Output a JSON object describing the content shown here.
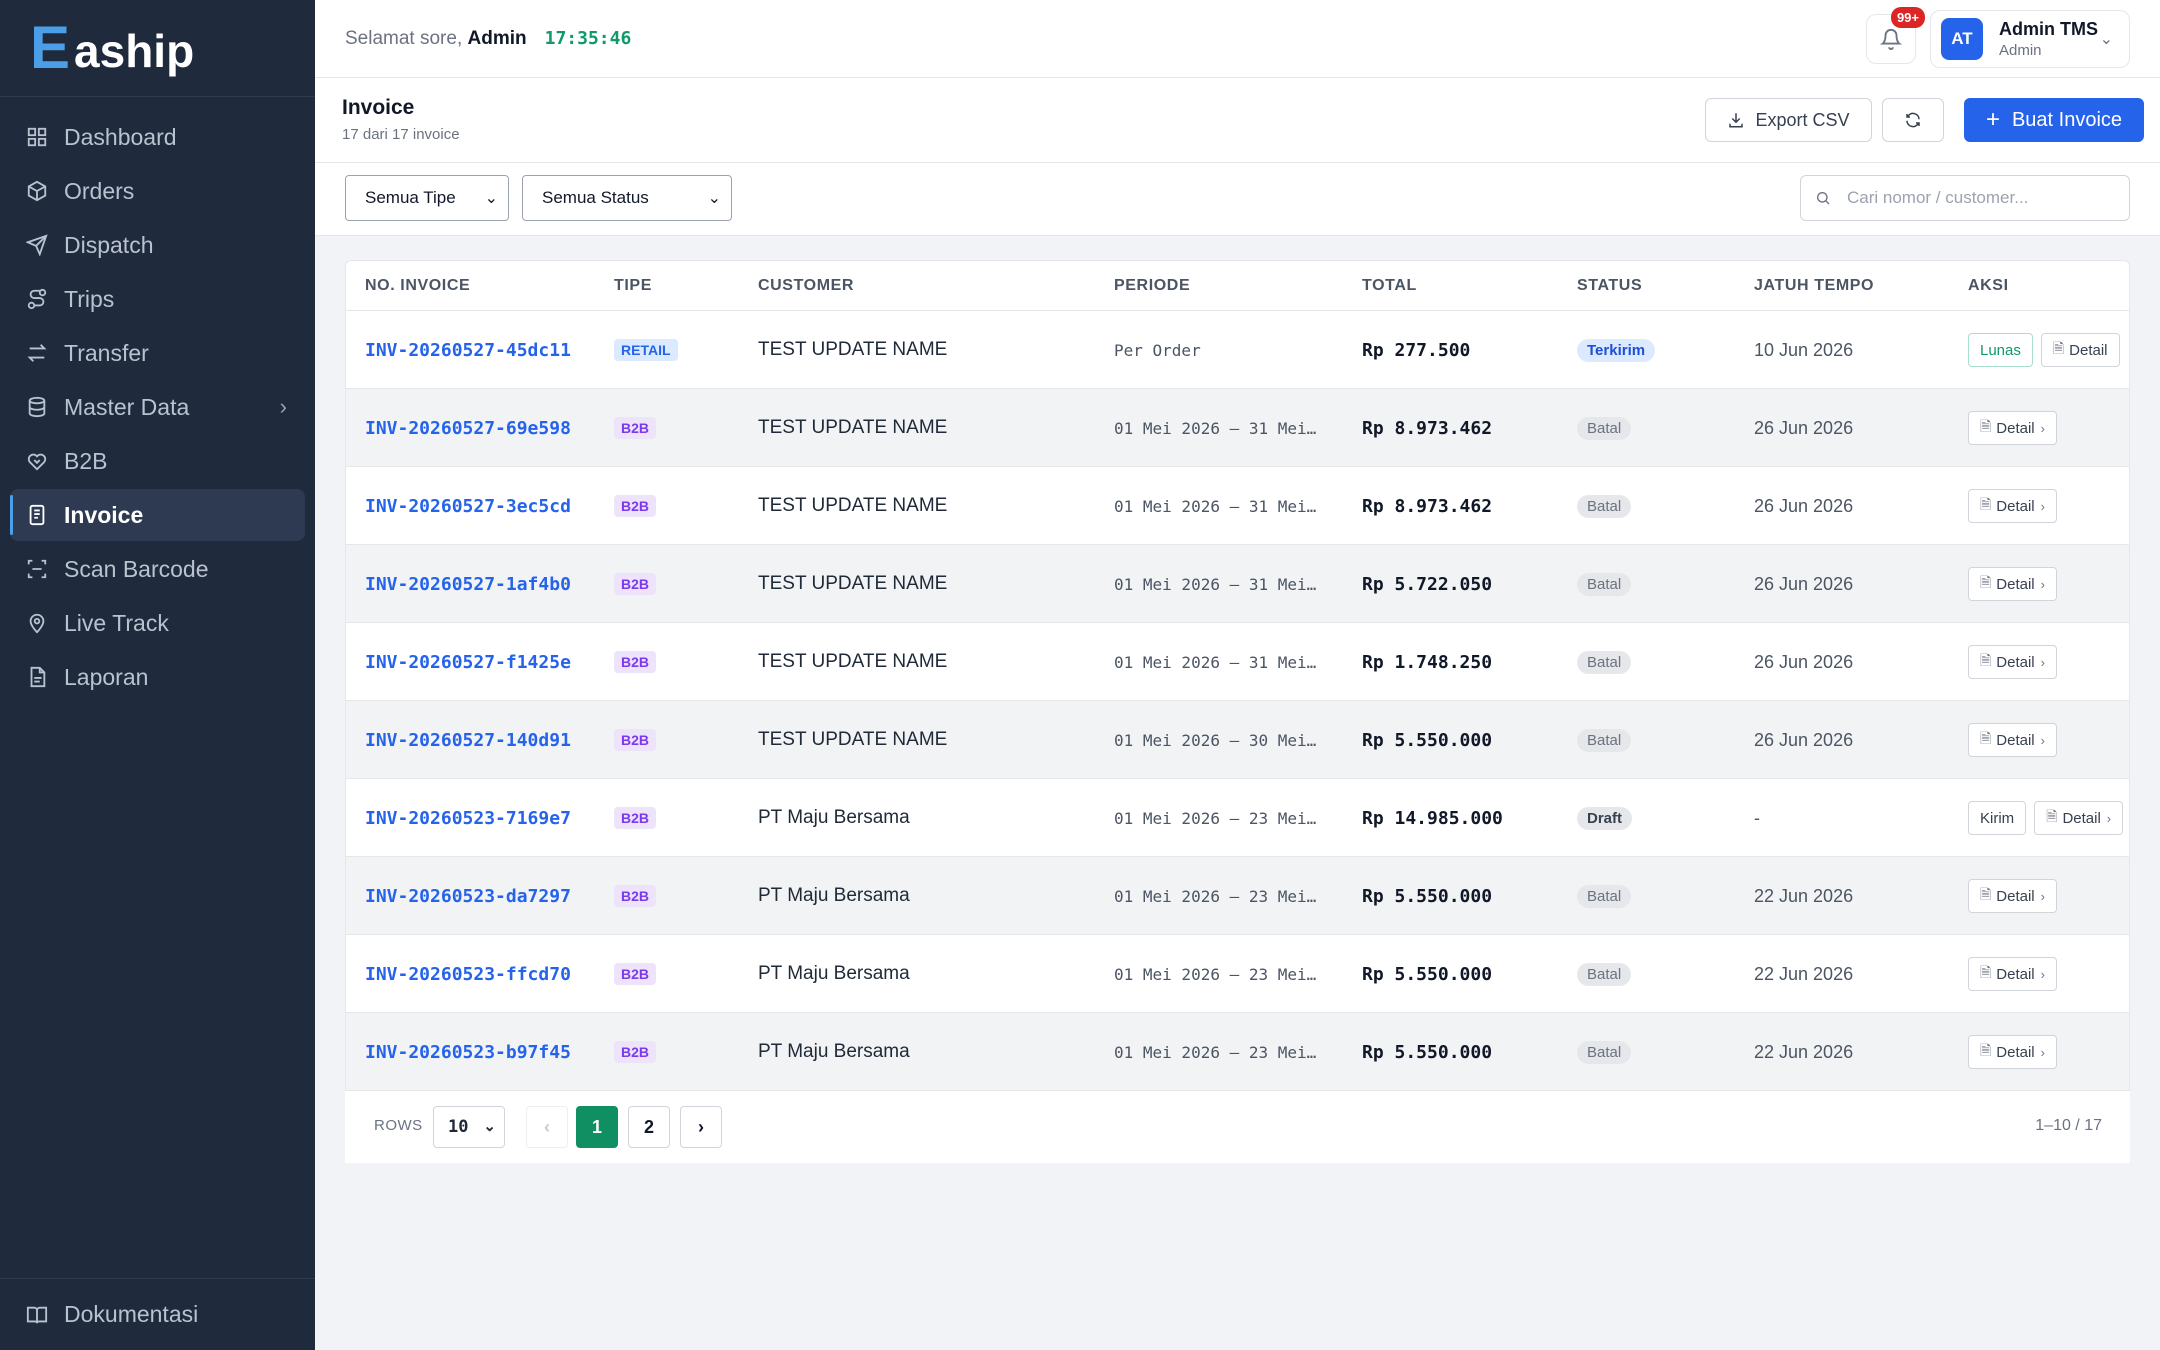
{
  "brand": {
    "mark": "E",
    "name": "aship"
  },
  "sidebar": {
    "items": [
      {
        "label": "Dashboard",
        "icon": "dashboard-icon"
      },
      {
        "label": "Orders",
        "icon": "box-icon"
      },
      {
        "label": "Dispatch",
        "icon": "send-icon"
      },
      {
        "label": "Trips",
        "icon": "route-icon"
      },
      {
        "label": "Transfer",
        "icon": "transfer-icon"
      },
      {
        "label": "Master Data",
        "icon": "database-icon"
      },
      {
        "label": "B2B",
        "icon": "handshake-icon"
      },
      {
        "label": "Invoice",
        "icon": "invoice-icon"
      },
      {
        "label": "Scan Barcode",
        "icon": "scan-icon"
      },
      {
        "label": "Live Track",
        "icon": "location-pin-icon"
      },
      {
        "label": "Laporan",
        "icon": "report-icon"
      }
    ],
    "active": "Invoice",
    "footer": "Dokumentasi"
  },
  "topbar": {
    "greeting": "Selamat sore,",
    "user_short": "Admin",
    "clock": "17:35:46",
    "notif_count": "99+",
    "avatar_initials": "AT",
    "user_name": "Admin TMS",
    "user_role": "Admin"
  },
  "page": {
    "title": "Invoice",
    "subtitle": "17 dari 17 invoice",
    "export_label": "Export CSV",
    "create_label": "Buat Invoice"
  },
  "filters": {
    "type_value": "Semua Tipe",
    "status_value": "Semua Status",
    "search_placeholder": "Cari nomor / customer..."
  },
  "table": {
    "headers": {
      "no": "NO. INVOICE",
      "tipe": "TIPE",
      "customer": "CUSTOMER",
      "periode": "PERIODE",
      "total": "TOTAL",
      "status": "STATUS",
      "due": "JATUH TEMPO",
      "aksi": "AKSI"
    },
    "rows": [
      {
        "no": "INV-20260527-45dc11",
        "tipe": "RETAIL",
        "customer": "TEST UPDATE NAME",
        "periode": "Per Order",
        "total": "Rp 277.500",
        "status": "Terkirim",
        "due": "10 Jun 2026",
        "action": "Lunas"
      },
      {
        "no": "INV-20260527-69e598",
        "tipe": "B2B",
        "customer": "TEST UPDATE NAME",
        "periode": "01 Mei 2026 — 31 Mei…",
        "total": "Rp 8.973.462",
        "status": "Batal",
        "due": "26 Jun 2026",
        "action": ""
      },
      {
        "no": "INV-20260527-3ec5cd",
        "tipe": "B2B",
        "customer": "TEST UPDATE NAME",
        "periode": "01 Mei 2026 — 31 Mei…",
        "total": "Rp 8.973.462",
        "status": "Batal",
        "due": "26 Jun 2026",
        "action": ""
      },
      {
        "no": "INV-20260527-1af4b0",
        "tipe": "B2B",
        "customer": "TEST UPDATE NAME",
        "periode": "01 Mei 2026 — 31 Mei…",
        "total": "Rp 5.722.050",
        "status": "Batal",
        "due": "26 Jun 2026",
        "action": ""
      },
      {
        "no": "INV-20260527-f1425e",
        "tipe": "B2B",
        "customer": "TEST UPDATE NAME",
        "periode": "01 Mei 2026 — 31 Mei…",
        "total": "Rp 1.748.250",
        "status": "Batal",
        "due": "26 Jun 2026",
        "action": ""
      },
      {
        "no": "INV-20260527-140d91",
        "tipe": "B2B",
        "customer": "TEST UPDATE NAME",
        "periode": "01 Mei 2026 — 30 Mei…",
        "total": "Rp 5.550.000",
        "status": "Batal",
        "due": "26 Jun 2026",
        "action": ""
      },
      {
        "no": "INV-20260523-7169e7",
        "tipe": "B2B",
        "customer": "PT Maju Bersama",
        "periode": "01 Mei 2026 — 23 Mei…",
        "total": "Rp 14.985.000",
        "status": "Draft",
        "due": "-",
        "action": "Kirim"
      },
      {
        "no": "INV-20260523-da7297",
        "tipe": "B2B",
        "customer": "PT Maju Bersama",
        "periode": "01 Mei 2026 — 23 Mei…",
        "total": "Rp 5.550.000",
        "status": "Batal",
        "due": "22 Jun 2026",
        "action": ""
      },
      {
        "no": "INV-20260523-ffcd70",
        "tipe": "B2B",
        "customer": "PT Maju Bersama",
        "periode": "01 Mei 2026 — 23 Mei…",
        "total": "Rp 5.550.000",
        "status": "Batal",
        "due": "22 Jun 2026",
        "action": ""
      },
      {
        "no": "INV-20260523-b97f45",
        "tipe": "B2B",
        "customer": "PT Maju Bersama",
        "periode": "01 Mei 2026 — 23 Mei…",
        "total": "Rp 5.550.000",
        "status": "Batal",
        "due": "22 Jun 2026",
        "action": ""
      }
    ],
    "detail_label": "Detail"
  },
  "pagination": {
    "rows_label": "ROWS",
    "rows_value": "10",
    "prev": "‹",
    "pages": [
      "1",
      "2"
    ],
    "current": "1",
    "next": "›",
    "info": "1–10 / 17"
  },
  "colors": {
    "sidebar_bg": "#1f2a3c",
    "primary": "#2563eb",
    "success": "#0f8f62",
    "danger": "#dc2626"
  }
}
